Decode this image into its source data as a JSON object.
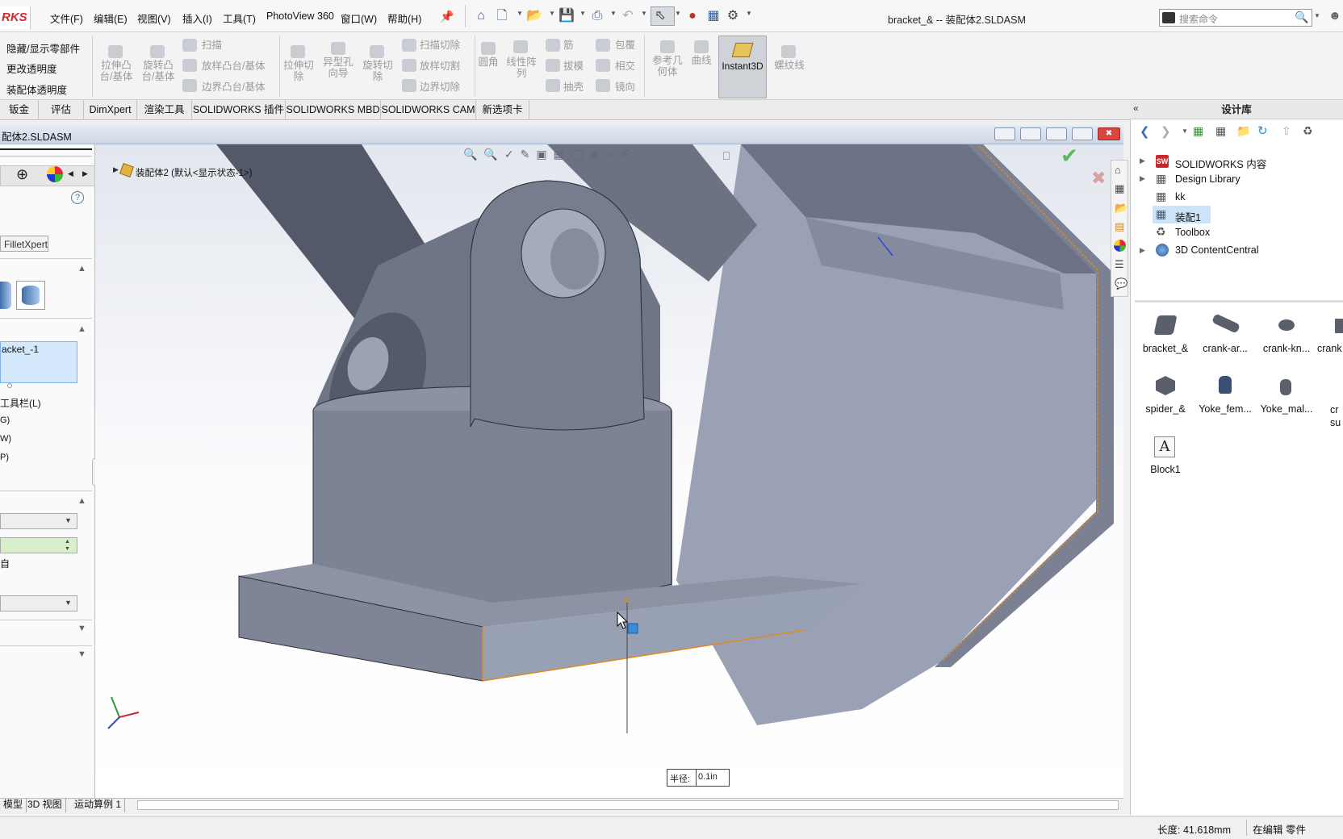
{
  "app": {
    "logo_text": "RKS"
  },
  "menu": [
    "文件(F)",
    "编辑(E)",
    "视图(V)",
    "插入(I)",
    "工具(T)",
    "PhotoView 360",
    "窗口(W)",
    "帮助(H)"
  ],
  "window_title": "bracket_& -- 装配体2.SLDASM",
  "search_placeholder": "搜索命令",
  "ribbon": {
    "left_items": [
      "隐藏/显示零部件",
      "更改透明度",
      "装配体透明度"
    ],
    "features": {
      "extrude_boss": "拉伸凸\n台/基体",
      "revolve_boss": "旋转凸\n台/基体",
      "sweep": "扫描",
      "loft": "放样凸台/基体",
      "boundary": "边界凸台/基体",
      "extrude_cut": "拉伸切\n除",
      "hole_wizard": "异型孔\n向导",
      "revolve_cut": "旋转切\n除",
      "sweep_cut": "扫描切除",
      "loft_cut": "放样切割",
      "boundary_cut": "边界切除",
      "fillet": "圆角",
      "linear_pattern": "线性阵\n列",
      "rib": "筋",
      "draft": "拔模",
      "shell": "抽壳",
      "wrap": "包覆",
      "intersect": "相交",
      "mirror": "镜向",
      "ref_geometry": "参考几\n何体",
      "curves": "曲线",
      "instant3d": "Instant3D",
      "helix": "螺纹线"
    }
  },
  "tabs": [
    "钣金",
    "评估",
    "DimXpert",
    "渲染工具",
    "SOLIDWORKS 插件",
    "SOLIDWORKS MBD",
    "SOLIDWORKS CAM",
    "新选项卡"
  ],
  "document": {
    "name": "配体2.SLDASM"
  },
  "left_panel": {
    "filletxpert": "FilletXpert",
    "selection": "acket_-1",
    "toolbar_item": "工具栏(L)",
    "options": [
      "G)",
      "W)",
      "P)"
    ],
    "tangent": "自"
  },
  "tree_root": "装配体2  (默认<显示状态-1>)",
  "dimension": {
    "label": "半径:",
    "value": "0.1in"
  },
  "right_panel": {
    "title": "设计库",
    "tree": [
      "SOLIDWORKS 内容",
      "Design Library",
      "kk",
      "装配1",
      "Toolbox",
      "3D ContentCentral"
    ],
    "library": [
      "bracket_&",
      "crank-ar...",
      "crank-kn...",
      "crank",
      "spider_&",
      "Yoke_fem...",
      "Yoke_mal...",
      "cr\nsu",
      "Block1"
    ]
  },
  "bottom_tabs": [
    "模型",
    "3D 视图",
    "运动算例 1"
  ],
  "status": {
    "length": "长度: 41.618mm",
    "mode": "在编辑 零件"
  },
  "colors": {
    "accent": "#d6262b",
    "part_gray": "#8a90a0",
    "edge_orange": "#e08a1e",
    "selection_blue": "#cfe6fb"
  }
}
